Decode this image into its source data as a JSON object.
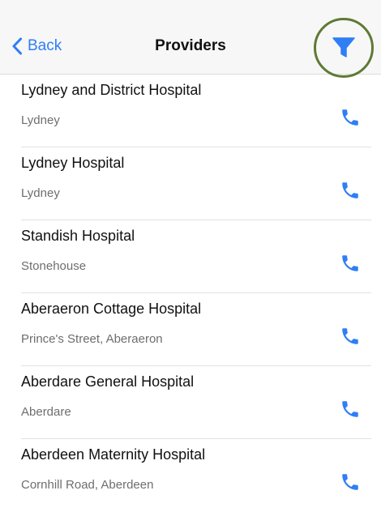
{
  "navbar": {
    "back_label": "Back",
    "title": "Providers",
    "filter_icon": "filter-icon",
    "accent_color": "#2f7ef5",
    "highlight_ring_color": "#5e7a34"
  },
  "providers": [
    {
      "name": "Lydney and District Hospital",
      "address": "Lydney"
    },
    {
      "name": "Lydney Hospital",
      "address": "Lydney"
    },
    {
      "name": "Standish Hospital",
      "address": "Stonehouse"
    },
    {
      "name": "Aberaeron Cottage Hospital",
      "address": "Prince's Street, Aberaeron"
    },
    {
      "name": "Aberdare General Hospital",
      "address": "Aberdare"
    },
    {
      "name": "Aberdeen Maternity Hospital",
      "address": "Cornhill Road, Aberdeen"
    }
  ],
  "row_icon": "phone-icon"
}
